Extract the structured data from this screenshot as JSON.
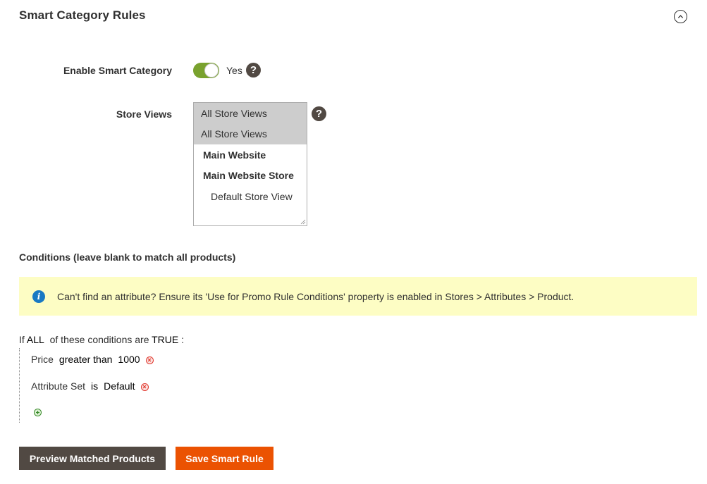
{
  "section": {
    "title": "Smart Category Rules"
  },
  "enable_smart_category": {
    "label": "Enable Smart Category",
    "value": "Yes",
    "enabled": true,
    "help": "?"
  },
  "store_views": {
    "label": "Store Views",
    "help": "?",
    "options": [
      {
        "label": "All Store Views",
        "selected": true
      },
      {
        "label": "All Store Views",
        "selected": true
      },
      {
        "label": "Main Website",
        "selected": false
      },
      {
        "label": "Main Website Store",
        "selected": false
      },
      {
        "label": "Default Store View",
        "selected": false
      }
    ]
  },
  "conditions": {
    "heading": "Conditions (leave blank to match all products)",
    "notice": "Can't find an attribute? Ensure its 'Use for Promo Rule Conditions' property is enabled in Stores > Attributes > Product.",
    "root": {
      "prefix": "If",
      "aggregator": "ALL",
      "middle": "of these conditions are",
      "value": "TRUE",
      "suffix": ":"
    },
    "rules": [
      {
        "attribute": "Price",
        "operator": "greater than",
        "value": "1000"
      },
      {
        "attribute": "Attribute Set",
        "operator": "is",
        "value": "Default"
      }
    ]
  },
  "buttons": {
    "preview": "Preview Matched Products",
    "save": "Save Smart Rule"
  },
  "colors": {
    "toggle_on": "#79a22e",
    "notice_bg": "#fdfdc4",
    "primary_button": "#eb5202",
    "secondary_button": "#514943",
    "info_icon": "#1979c3"
  }
}
